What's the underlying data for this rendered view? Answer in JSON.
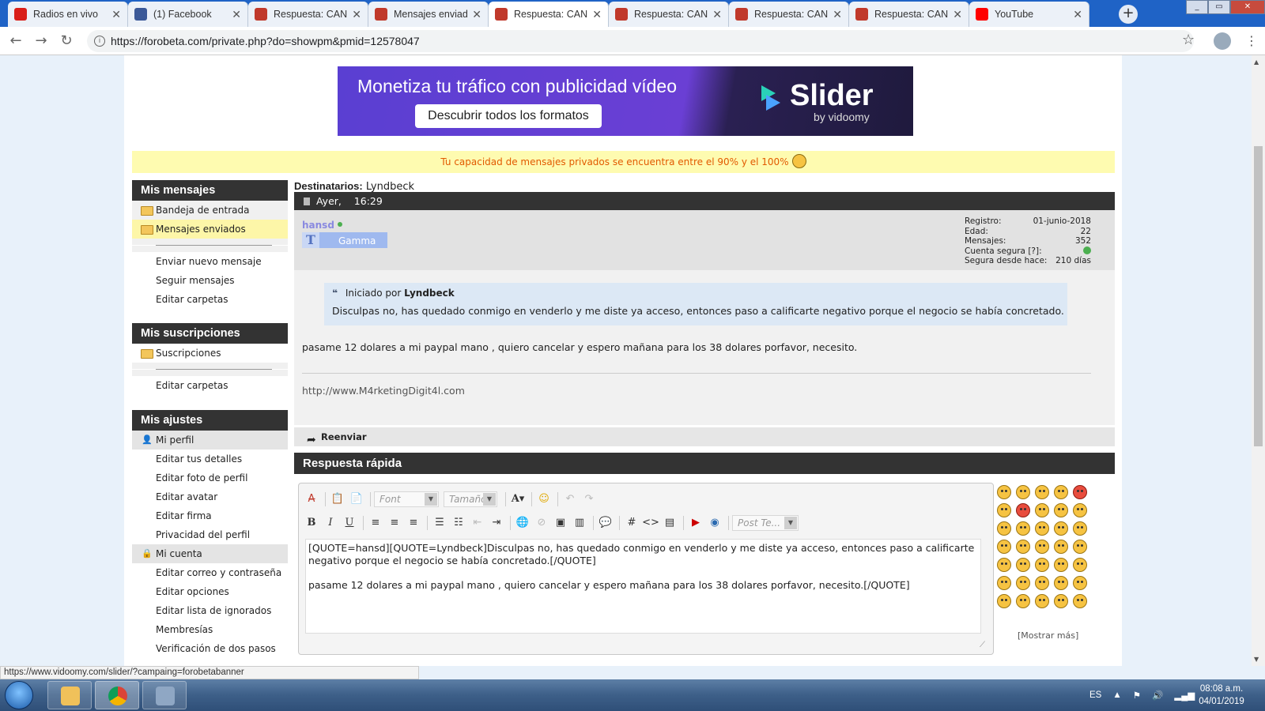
{
  "browser": {
    "tabs": [
      {
        "title": "Radios en vivo",
        "favicon": "peru-flag-icon",
        "color": "#d91e18"
      },
      {
        "title": "(1) Facebook",
        "favicon": "facebook-icon",
        "color": "#3b5998"
      },
      {
        "title": "Respuesta: CANAL",
        "favicon": "forobeta-icon",
        "color": "#c0392b"
      },
      {
        "title": "Mensajes enviados",
        "favicon": "forobeta-icon",
        "color": "#c0392b"
      },
      {
        "title": "Respuesta: CANAL",
        "favicon": "forobeta-icon",
        "color": "#c0392b",
        "active": true
      },
      {
        "title": "Respuesta: CANAL",
        "favicon": "forobeta-icon",
        "color": "#c0392b"
      },
      {
        "title": "Respuesta: CANAL",
        "favicon": "forobeta-icon",
        "color": "#c0392b"
      },
      {
        "title": "Respuesta: CANAL",
        "favicon": "forobeta-icon",
        "color": "#c0392b"
      },
      {
        "title": "YouTube",
        "favicon": "youtube-icon",
        "color": "#ff0000"
      }
    ],
    "url": "https://forobeta.com/private.php?do=showpm&pmid=12578047",
    "status_url": "https://www.vidoomy.com/slider/?campaing=forobetabanner"
  },
  "banner": {
    "headline": "Monetiza tu tráfico con publicidad vídeo",
    "cta": "Descubrir todos los formatos",
    "brand": "Slider",
    "by": "by vidoomy"
  },
  "notice": "Tu capacidad de mensajes privados se encuentra entre el 90% y el 100%",
  "sidebar": {
    "messages": {
      "title": "Mis mensajes",
      "folders": [
        "Bandeja de entrada",
        "Mensajes enviados"
      ],
      "links": [
        "Enviar nuevo mensaje",
        "Seguir mensajes",
        "Editar carpetas"
      ]
    },
    "subscriptions": {
      "title": "Mis suscripciones",
      "folders": [
        "Suscripciones"
      ],
      "links": [
        "Editar carpetas"
      ]
    },
    "settings": {
      "title": "Mis ajustes",
      "profile_cat": "Mi perfil",
      "profile_links": [
        "Editar tus detalles",
        "Editar foto de perfil",
        "Editar avatar",
        "Editar firma",
        "Privacidad del perfil"
      ],
      "account_cat": "Mi cuenta",
      "account_links": [
        "Editar correo y contraseña",
        "Editar opciones",
        "Editar lista de ignorados",
        "Membresías",
        "Verificación de dos pasos"
      ]
    }
  },
  "message": {
    "recipients_label": "Destinatarios:",
    "recipient": "Lyndbeck",
    "date": "Ayer,",
    "time": "16:29",
    "user": "hansd",
    "rank": "Gamma",
    "rank_letter": "T",
    "stats": [
      {
        "k": "Registro:",
        "v": "01-junio-2018"
      },
      {
        "k": "Edad:",
        "v": "22"
      },
      {
        "k": "Mensajes:",
        "v": "352"
      },
      {
        "k": "Cuenta segura [?]:",
        "v": ""
      },
      {
        "k": "Segura desde hace:",
        "v": "210 días"
      }
    ],
    "quote_prefix": "Iniciado por",
    "quote_author": "Lyndbeck",
    "quote_text": "Disculpas no, has quedado conmigo en venderlo y me diste ya acceso, entonces paso a calificarte negativo porque el negocio se había concretado.",
    "body": "pasame 12 dolares a mi paypal mano , quiero cancelar y espero mañana para los 38 dolares porfavor, necesito.",
    "signature": "http://www.M4rketingDigit4l.com",
    "forward": "Reenviar"
  },
  "quick_reply": {
    "title": "Respuesta rápida",
    "font_placeholder": "Font",
    "size_placeholder": "Tamaño",
    "post_placeholder": "Post Te...",
    "text": "[QUOTE=hansd][QUOTE=Lyndbeck]Disculpas no, has quedado conmigo en venderlo y me diste ya acceso, entonces paso a calificarte negativo porque el negocio se había concretado.[/QUOTE]\n\npasame 12 dolares a mi paypal mano , quiero cancelar y espero mañana para los 38 dolares porfavor, necesito.[/QUOTE]",
    "more": "[Mostrar más]"
  },
  "taskbar": {
    "lang": "ES",
    "time": "08:08 a.m.",
    "date": "04/01/2019"
  }
}
